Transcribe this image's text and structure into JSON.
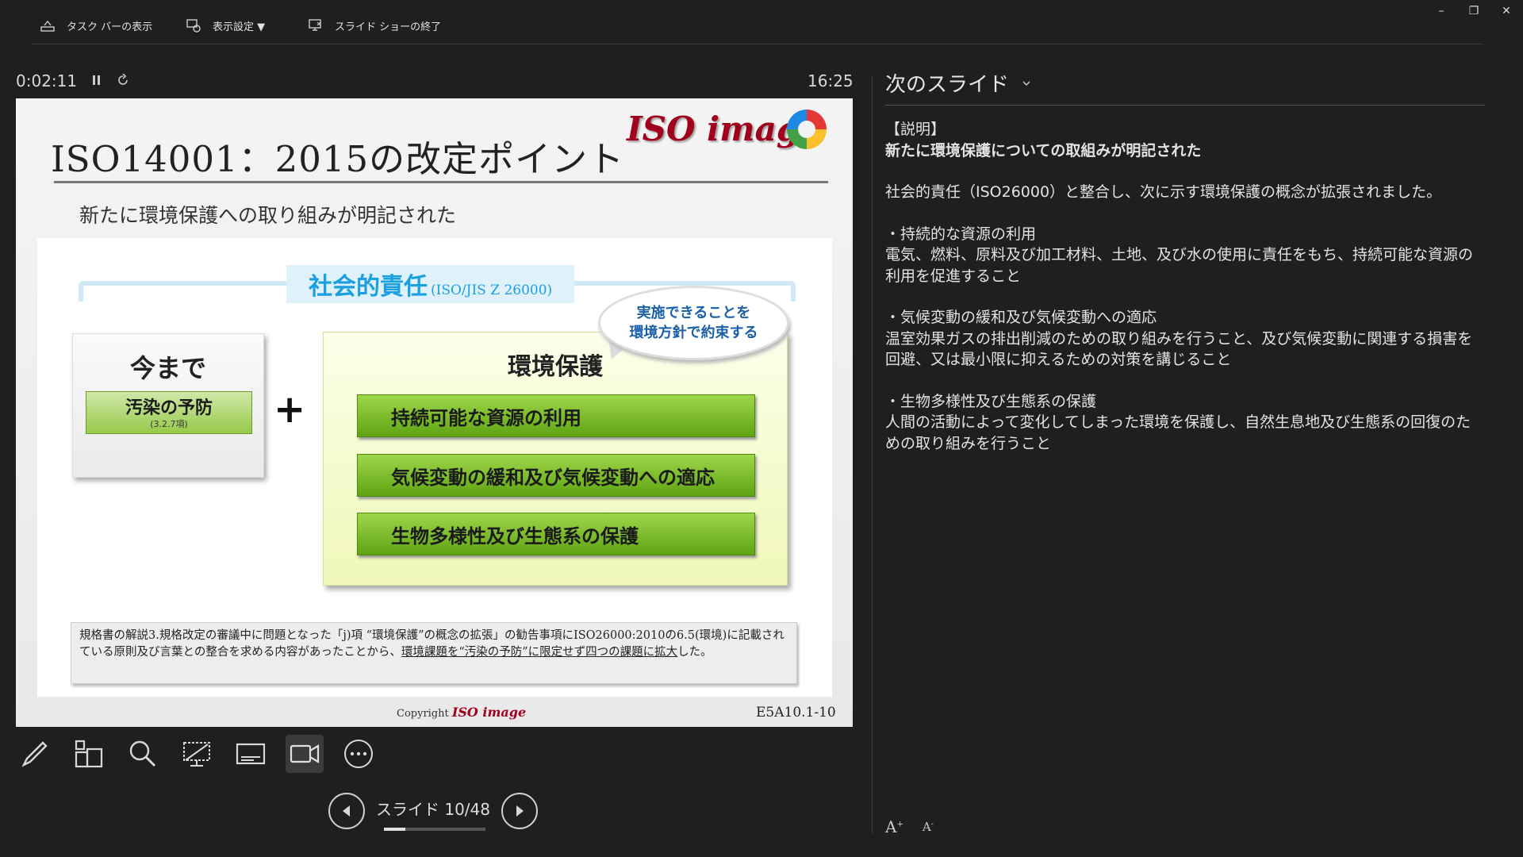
{
  "toolbar": {
    "taskbar_label": "タスク バーの表示",
    "display_label": "表示設定 ▼",
    "end_label": "スライド ショーの終了"
  },
  "window_controls": {
    "minimize": "–",
    "restore": "❐",
    "close": "✕"
  },
  "presenter": {
    "elapsed": "0:02:11",
    "clock": "16:25"
  },
  "slide": {
    "title": "ISO14001：2015の改定ポイント",
    "logo_text": "ISO image",
    "subtitle": "新たに環境保護への取り組みが明記された",
    "social_main": "社会的責任",
    "social_ref": "(ISO/JIS Z 26000)",
    "bubble_line1": "実施できることを",
    "bubble_line2": "環境方針で約束する",
    "before_title": "今まで",
    "before_item": "汚染の予防",
    "before_item_ref": "(3.2.7項)",
    "plus": "+",
    "env_title": "環境保護",
    "env_items": [
      "持続可能な資源の利用",
      "気候変動の緩和及び気候変動への適応",
      "生物多様性及び生態系の保護"
    ],
    "note_normal": "規格書の解説3.規格改定の審議中に問題となった「j)項 “環境保護”の概念の拡張」の勧告事項にISO26000:2010の6.5(環境)に記載されている原則及び言葉との整合を求める内容があったことから、",
    "note_underlined": "環境課題を“汚染の予防”に限定せず四つの課題に拡大",
    "note_tail": "した。",
    "footer_copyright": "Copyright",
    "footer_logo": "ISO image",
    "code": "E5A10.1-10"
  },
  "navigation": {
    "slide_label": "スライド 10/48",
    "progress": 0.2083
  },
  "next_slide": {
    "header": "次のスライド"
  },
  "notes": {
    "heading1": "【説明】",
    "heading2": "新たに環境保護についての取組みが明記された",
    "para1": "社会的責任（ISO26000）と整合し、次に示す環境保護の概念が拡張されました。",
    "b1_title": "・持続的な資源の利用",
    "b1_text": "電気、燃料、原料及び加工材料、土地、及び水の使用に責任をもち、持続可能な資源の利用を促進すること",
    "b2_title": "・気候変動の緩和及び気候変動への適応",
    "b2_text": "温室効果ガスの排出削減のための取り組みを行うこと、及び気候変動に関連する損害を回避、又は最小限に抑えるための対策を講じること",
    "b3_title": "・生物多様性及び生態系の保護",
    "b3_text": "人間の活動によって変化してしまった環境を保護し、自然生息地及び生態系の回復のための取り組みを行うこと"
  },
  "font_controls": {
    "increase": "A",
    "decrease": "A"
  },
  "icons": [
    "taskbar-icon",
    "display-settings-icon",
    "end-show-icon",
    "pause-icon",
    "restart-icon",
    "pen-icon",
    "all-slides-icon",
    "zoom-icon",
    "pointer-screen-icon",
    "subtitles-icon",
    "camera-icon",
    "more-icon",
    "prev-arrow-icon",
    "next-arrow-icon",
    "chevron-down-icon"
  ]
}
